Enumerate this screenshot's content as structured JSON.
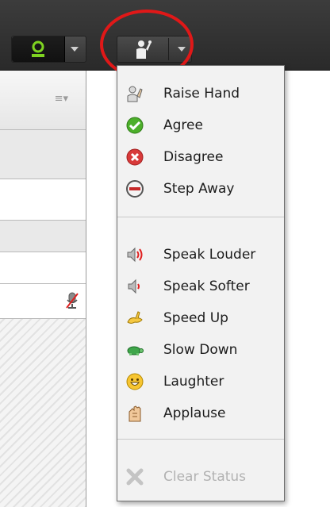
{
  "toolbar": {
    "camera_icon": "webcam-icon",
    "status_icon": "raised-hand-person-icon"
  },
  "left_panel": {
    "header_icon": "menu-lines-icon",
    "row_icon": "muted-microphone-icon"
  },
  "status_menu": {
    "groups": [
      [
        {
          "label": "Raise Hand",
          "icon": "raise-hand-icon"
        },
        {
          "label": "Agree",
          "icon": "agree-icon"
        },
        {
          "label": "Disagree",
          "icon": "disagree-icon"
        },
        {
          "label": "Step Away",
          "icon": "step-away-icon"
        }
      ],
      [
        {
          "label": "Speak Louder",
          "icon": "speaker-loud-icon"
        },
        {
          "label": "Speak Softer",
          "icon": "speaker-soft-icon"
        },
        {
          "label": "Speed Up",
          "icon": "rabbit-icon"
        },
        {
          "label": "Slow Down",
          "icon": "turtle-icon"
        },
        {
          "label": "Laughter",
          "icon": "smiley-icon"
        },
        {
          "label": "Applause",
          "icon": "clapping-hands-icon"
        }
      ],
      [
        {
          "label": "Clear Status",
          "icon": "clear-x-icon",
          "disabled": true
        }
      ]
    ]
  },
  "colors": {
    "highlight_ring": "#e01818",
    "agree_green": "#4caf2a",
    "disagree_red": "#d83a3a",
    "disabled_text": "#b2b2b2"
  }
}
